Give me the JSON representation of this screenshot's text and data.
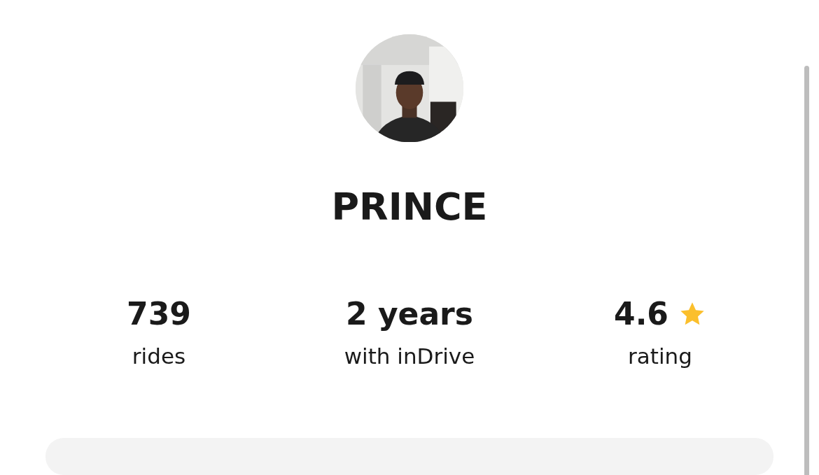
{
  "profile": {
    "name": "PRINCE"
  },
  "stats": [
    {
      "kind": "count",
      "value": "739",
      "label": "rides"
    },
    {
      "kind": "duration",
      "value": "2 years",
      "label": "with inDrive"
    },
    {
      "kind": "rating",
      "value": "4.6",
      "label": "rating"
    }
  ]
}
